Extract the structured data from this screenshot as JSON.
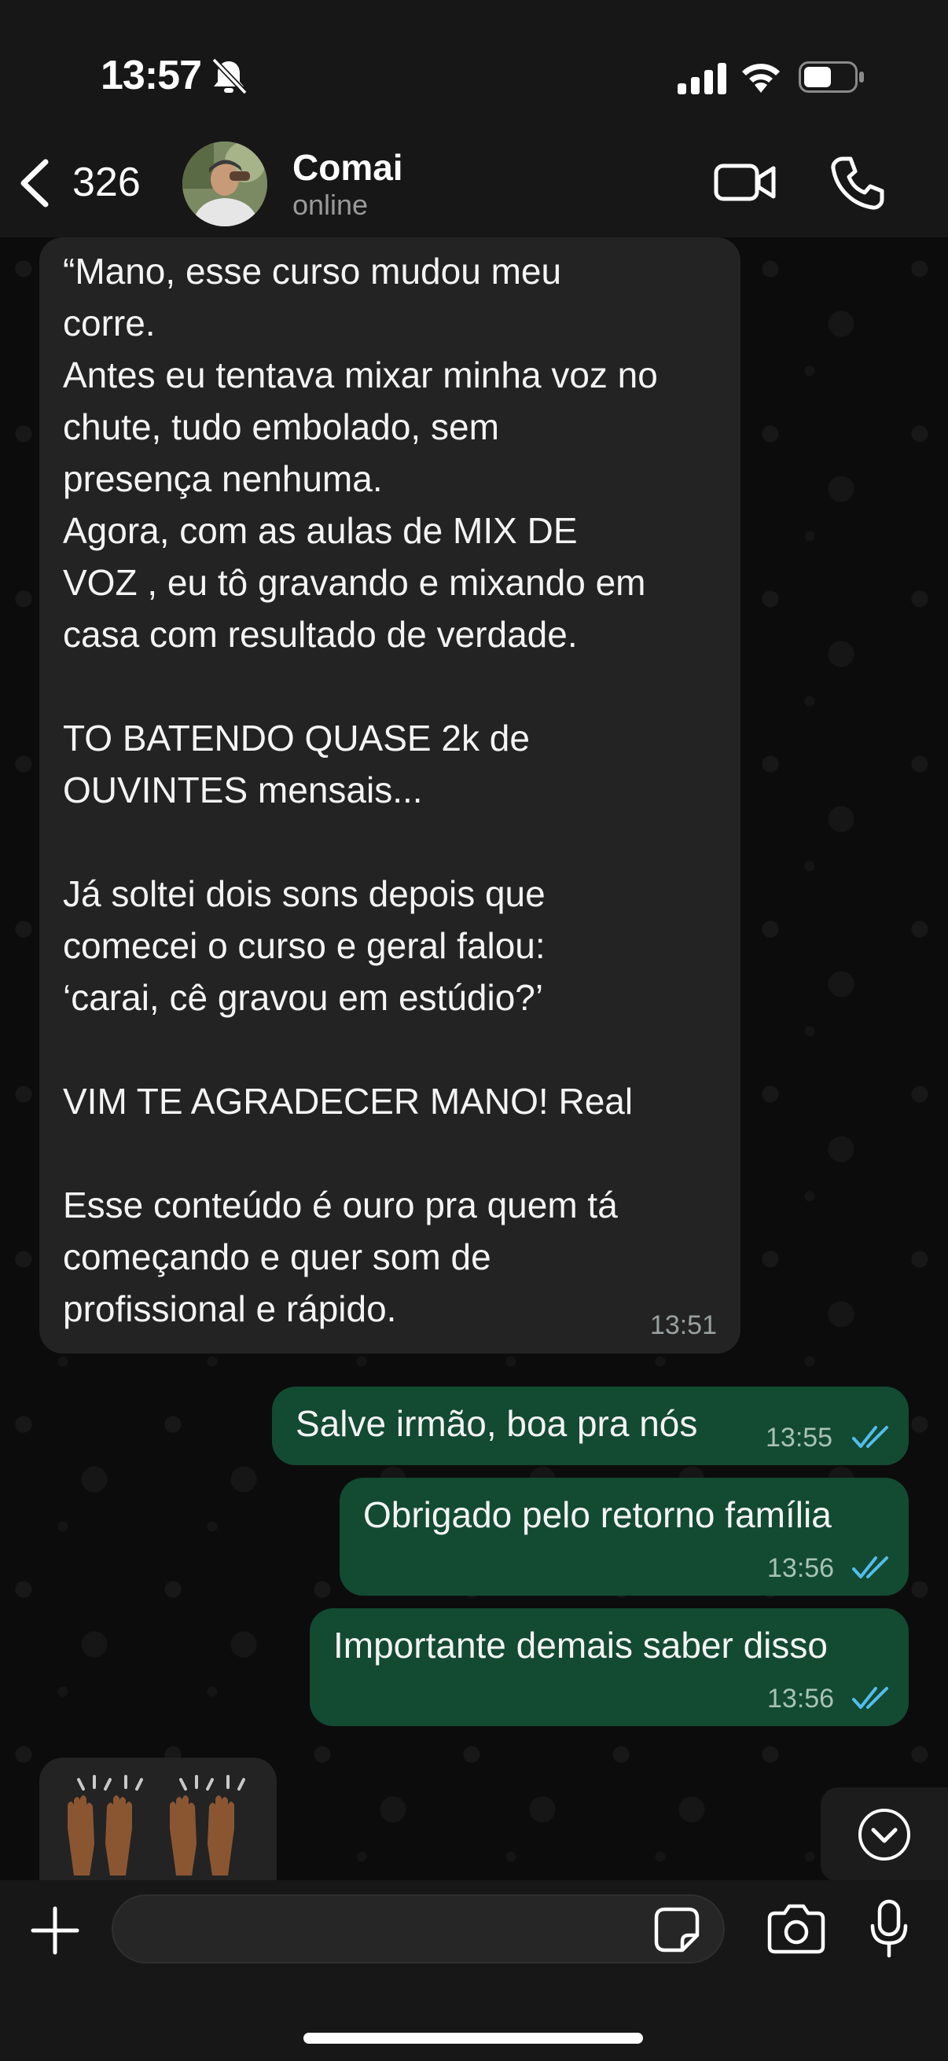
{
  "status_bar": {
    "time": "13:57",
    "icons": [
      "bell-muted-icon",
      "signal-icon",
      "wifi-icon",
      "battery-icon"
    ]
  },
  "header": {
    "back_count": "326",
    "contact_name": "Comai",
    "contact_status": "online",
    "actions": [
      "video-call-icon",
      "phone-icon"
    ]
  },
  "messages": [
    {
      "direction": "incoming",
      "text": "“Mano, esse curso mudou meu\ncorre.\nAntes eu tentava mixar minha voz no\nchute, tudo embolado, sem\npresença nenhuma.\nAgora, com as aulas de MIX DE\nVOZ , eu tô gravando e mixando em\ncasa com resultado de verdade.\n\nTO BATENDO QUASE 2k de\nOUVINTES mensais...\n\nJá soltei dois sons depois que\ncomecei o curso e geral falou:\n‘carai, cê gravou em estúdio?’\n\nVIM TE AGRADECER MANO! Real\n\nEsse conteúdo é ouro pra quem tá\ncomeçando e quer som de\nprofissional e rápido.",
      "time": "13:51"
    },
    {
      "direction": "outgoing",
      "text": "Salve irmão, boa pra nós",
      "time": "13:55",
      "status": "read"
    },
    {
      "direction": "outgoing",
      "text": "Obrigado pelo retorno família",
      "time": "13:56",
      "status": "read"
    },
    {
      "direction": "outgoing",
      "text": "Importante demais saber disso",
      "time": "13:56",
      "status": "read"
    },
    {
      "direction": "incoming",
      "emoji": "raising-hands-emoji x2"
    }
  ],
  "input": {
    "placeholder": "",
    "value": ""
  },
  "colors": {
    "incoming_bubble": "#232323",
    "outgoing_bubble": "#134a32",
    "read_ticks": "#53bdeb",
    "bar_background": "#171717"
  }
}
